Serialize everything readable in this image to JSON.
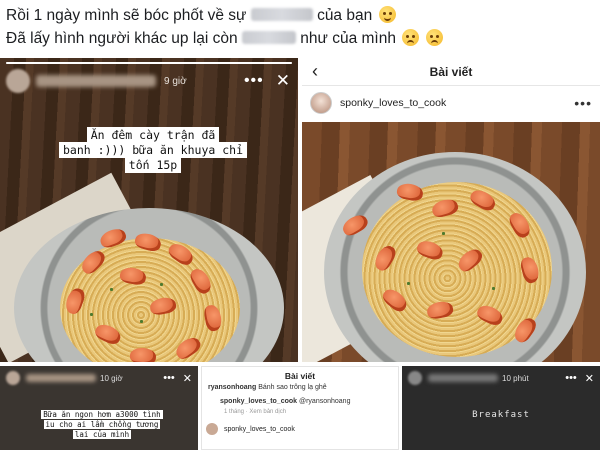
{
  "post": {
    "line1_a": "Rồi 1 ngày mình sẽ bóc phốt về sự",
    "line1_b": "của bạn",
    "line2_a": "Đã lấy hình người khác up lại còn",
    "line2_b": "như của mình"
  },
  "story_left": {
    "time": "9 giờ",
    "caption_lines": [
      "Ăn đêm cày trận đã",
      "banh :))) bữa ăn khuya chỉ",
      "tốn 15p"
    ],
    "progress": 1.0
  },
  "insta_post": {
    "header_title": "Bài viết",
    "username": "sponky_loves_to_cook"
  },
  "bottom": {
    "story1": {
      "time": "10 giờ",
      "caption_lines": [
        "Bữa ăn ngon hơm a3000 tình",
        "iu cho ai lầm chồng tương",
        "lai của mình"
      ]
    },
    "post2": {
      "title": "Bài viết",
      "comment1_user": "ryansonhoang",
      "comment1_text": "Bánh sao trông lạ ghê",
      "comment2_user": "sponky_loves_to_cook",
      "comment2_text": "@ryansonhoang",
      "comment_meta": "1 tháng ·   Xem bản dịch",
      "username": "sponky_loves_to_cook"
    },
    "story3": {
      "time": "10 phút",
      "caption": "Breakfast"
    }
  },
  "icons": {
    "more": "more-dots-icon",
    "close": "close-icon",
    "back": "back-arrow-icon",
    "emoji_smile": "smile-emoji-icon",
    "emoji_cry": "cry-emoji-icon"
  }
}
